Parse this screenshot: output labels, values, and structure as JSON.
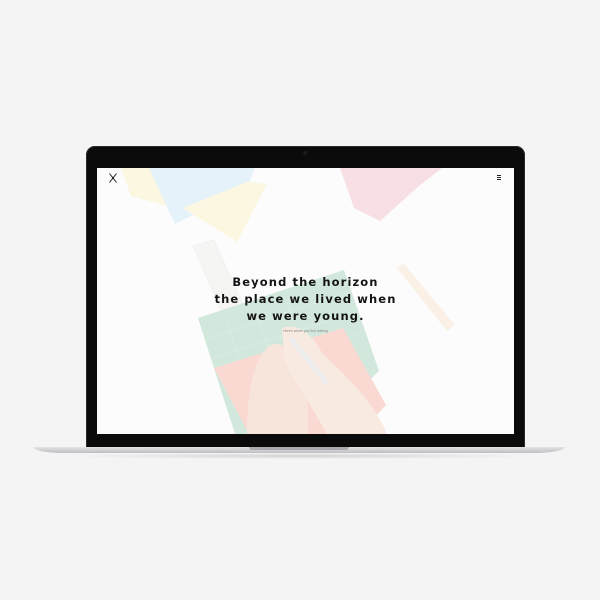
{
  "brand": {
    "logo_icon": "crossed-needles-logo-icon"
  },
  "nav": {
    "menu_icon": "hamburger-menu-icon"
  },
  "hero": {
    "line1": "Beyond the horizon",
    "line2": "the place we lived when",
    "line3": "we were young.",
    "subtitle": "Here's where you find nothing"
  },
  "colors": {
    "page_background": "#f4f4f4",
    "bezel": "#0b0b0b",
    "screen_background": "#fbfbfc",
    "heading_text": "#141414",
    "paper_pink": "#f6d3d8",
    "paper_blue": "#dceef7",
    "paper_yellow": "#fbf4d4",
    "mat_green": "#b9d9c8",
    "notebook_coral": "#f7c6b9"
  }
}
